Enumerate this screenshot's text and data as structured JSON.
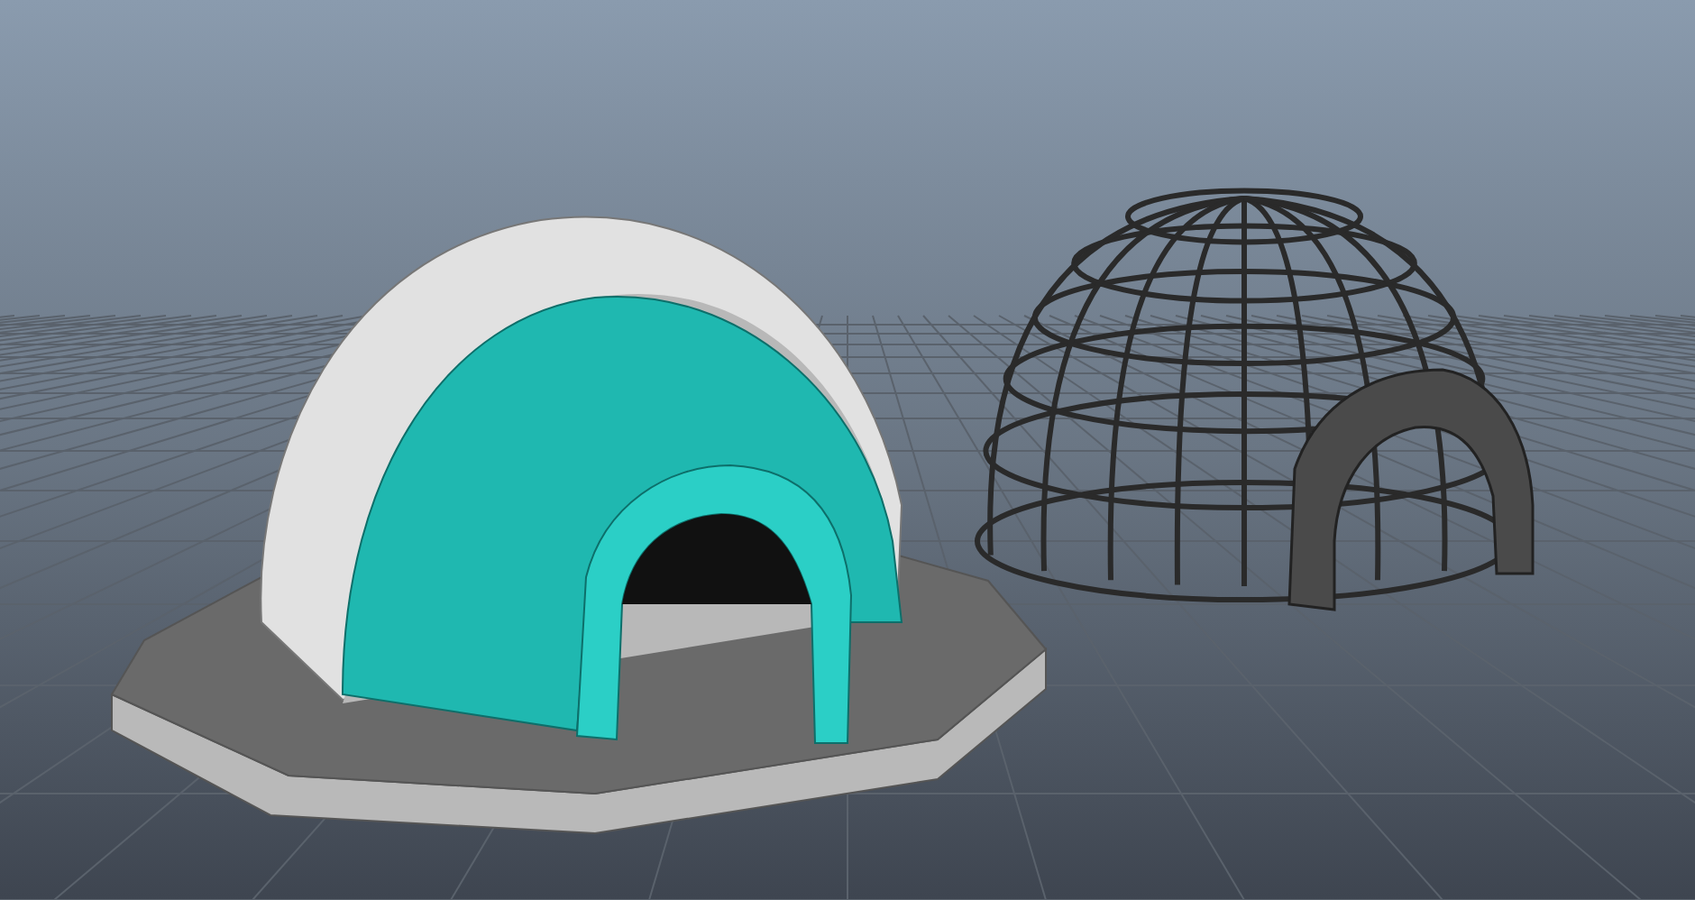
{
  "scene": {
    "objects": [
      {
        "kind": "solid-dome"
      },
      {
        "kind": "wireframe-dome"
      }
    ]
  }
}
